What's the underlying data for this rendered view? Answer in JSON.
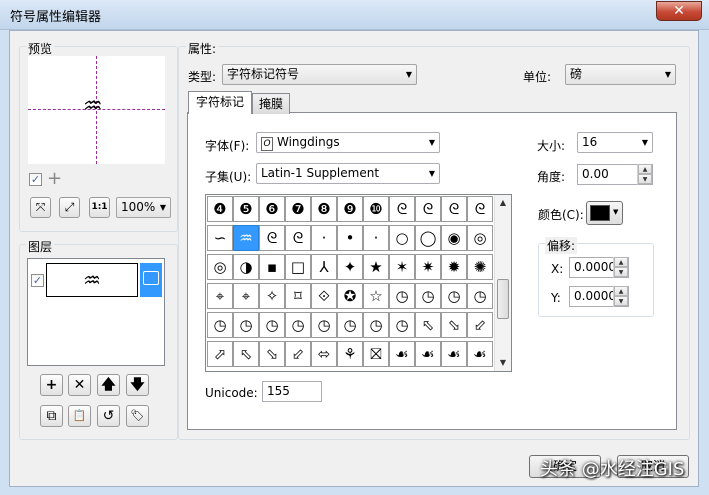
{
  "window": {
    "title": "符号属性编辑器",
    "close_glyph": "✕"
  },
  "preview": {
    "label": "预览",
    "symbol": "♒",
    "check": "✓",
    "plus": "+",
    "zoom": "100%",
    "btn_fit": "⤧",
    "btn_full": "⤢",
    "btn_actual": "1:1"
  },
  "layers": {
    "label": "图层",
    "check": "✓",
    "symbol": "♒",
    "lock_glyph": "🔒",
    "buttons": {
      "add": "+",
      "remove": "✕",
      "up": "🡅",
      "down": "🡇",
      "copy": "⧉",
      "paste": "📋",
      "reset": "↺",
      "tag": "🏷"
    }
  },
  "properties": {
    "label": "属性:",
    "type_label": "类型:",
    "type_value": "字符标记符号",
    "unit_label": "单位:",
    "unit_value": "磅"
  },
  "tabs": [
    {
      "label": "字符标记"
    },
    {
      "label": "掩膜"
    }
  ],
  "font": {
    "label": "字体(F):",
    "value": "Wingdings",
    "icon": "O"
  },
  "subset": {
    "label": "子集(U):",
    "value": "Latin-1 Supplement"
  },
  "size": {
    "label": "大小:",
    "value": "16"
  },
  "angle": {
    "label": "角度:",
    "value": "0.00"
  },
  "color": {
    "label": "颜色(C):",
    "value": "#000000"
  },
  "offset": {
    "label": "偏移:",
    "x_label": "X:",
    "x_value": "0.0000",
    "y_label": "Y:",
    "y_value": "0.0000"
  },
  "glyphs": [
    [
      "❹",
      "❺",
      "❻",
      "❼",
      "❽",
      "❾",
      "❿",
      "ᘓ",
      "ᘓ",
      "ᘓ",
      "ᘓ"
    ],
    [
      "∽",
      "♒",
      "ᘓ",
      "ᘓ",
      "·",
      "•",
      "·",
      "○",
      "◯",
      "◉",
      "◎"
    ],
    [
      "◎",
      "◑",
      "▪",
      "□",
      "⅄",
      "✦",
      "★",
      "✶",
      "✷",
      "✹",
      "✺"
    ],
    [
      "⌖",
      "⌖",
      "✧",
      "⌑",
      "⟐",
      "✪",
      "☆",
      "◷",
      "◷",
      "◷",
      "◷"
    ],
    [
      "◷",
      "◷",
      "◷",
      "◷",
      "◷",
      "◷",
      "◷",
      "◷",
      "⬁",
      "⬂",
      "⬃"
    ],
    [
      "⬀",
      "⬁",
      "⬂",
      "⬃",
      "⬄",
      "⚘",
      "⛝",
      "☙",
      "☙",
      "☙",
      "☙"
    ]
  ],
  "selected_glyph": "1,1",
  "unicode": {
    "label": "Unicode:",
    "value": "155"
  },
  "buttons": {
    "ok": "确定",
    "cancel": "取消"
  },
  "watermark": "头条 @水经注GIS"
}
